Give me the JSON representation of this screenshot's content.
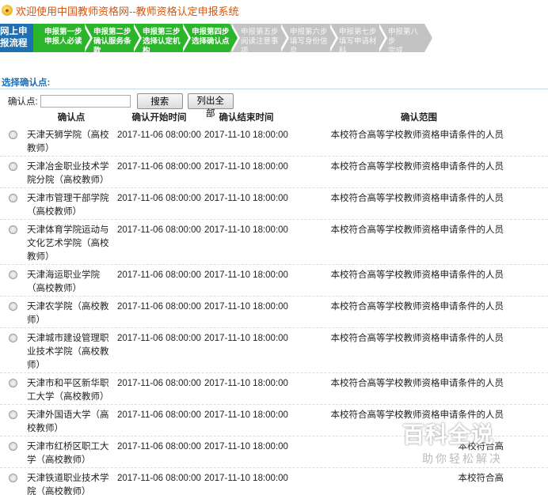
{
  "header": {
    "title": "欢迎使用中国教师资格网--教师资格认定申报系统"
  },
  "steps": [
    {
      "line1": "网上申",
      "line2": "报流程",
      "state": "current"
    },
    {
      "line1": "申报第一步",
      "line2": "申报人必读",
      "state": "done"
    },
    {
      "line1": "申报第二步",
      "line2": "确认服务条款",
      "state": "done"
    },
    {
      "line1": "申报第三步",
      "line2": "选择认定机构",
      "state": "done"
    },
    {
      "line1": "申报第四步",
      "line2": "选择确认点",
      "state": "done"
    },
    {
      "line1": "申报第五步",
      "line2": "阅读注意事项",
      "state": "todo"
    },
    {
      "line1": "申报第六步",
      "line2": "填写身份信息",
      "state": "todo"
    },
    {
      "line1": "申报第七步",
      "line2": "填写申请材料",
      "state": "todo"
    },
    {
      "line1": "申报第八步",
      "line2": "完成",
      "state": "todo"
    }
  ],
  "section": {
    "label": "选择确认点:"
  },
  "search": {
    "label": "确认点:",
    "value": "",
    "search_button": "搜索",
    "list_all_button": "列出全部"
  },
  "table": {
    "headers": [
      "确认点",
      "确认开始时间",
      "确认结束时间",
      "确认范围"
    ],
    "rows": [
      {
        "name": "天津天狮学院（高校教师）",
        "start": "2017-11-06 08:00:00",
        "end": "2017-11-10 18:00:00",
        "scope": "本校符合高等学校教师资格申请条件的人员"
      },
      {
        "name": "天津冶金职业技术学院分院（高校教师）",
        "start": "2017-11-06 08:00:00",
        "end": "2017-11-10 18:00:00",
        "scope": "本校符合高等学校教师资格申请条件的人员"
      },
      {
        "name": "天津市管理干部学院（高校教师）",
        "start": "2017-11-06 08:00:00",
        "end": "2017-11-10 18:00:00",
        "scope": "本校符合高等学校教师资格申请条件的人员"
      },
      {
        "name": "天津体育学院运动与文化艺术学院（高校教师）",
        "start": "2017-11-06 08:00:00",
        "end": "2017-11-10 18:00:00",
        "scope": "本校符合高等学校教师资格申请条件的人员"
      },
      {
        "name": "天津海运职业学院（高校教师）",
        "start": "2017-11-06 08:00:00",
        "end": "2017-11-10 18:00:00",
        "scope": "本校符合高等学校教师资格申请条件的人员"
      },
      {
        "name": "天津农学院（高校教师）",
        "start": "2017-11-06 08:00:00",
        "end": "2017-11-10 18:00:00",
        "scope": "本校符合高等学校教师资格申请条件的人员"
      },
      {
        "name": "天津城市建设管理职业技术学院（高校教师）",
        "start": "2017-11-06 08:00:00",
        "end": "2017-11-10 18:00:00",
        "scope": "本校符合高等学校教师资格申请条件的人员"
      },
      {
        "name": "天津市和平区新华职工大学（高校教师）",
        "start": "2017-11-06 08:00:00",
        "end": "2017-11-10 18:00:00",
        "scope": "本校符合高等学校教师资格申请条件的人员"
      },
      {
        "name": "天津外国语大学（高校教师）",
        "start": "2017-11-06 08:00:00",
        "end": "2017-11-10 18:00:00",
        "scope": "本校符合高等学校教师资格申请条件的人员"
      },
      {
        "name": "天津市红桥区职工大学（高校教师）",
        "start": "2017-11-06 08:00:00",
        "end": "2017-11-10 18:00:00",
        "scope": "本校符合高"
      },
      {
        "name": "天津铁道职业技术学院（高校教师）",
        "start": "2017-11-06 08:00:00",
        "end": "2017-11-10 18:00:00",
        "scope": "本校符合高"
      }
    ]
  },
  "watermark": {
    "big": "百科全说",
    "small": "助你轻松解决"
  },
  "colors": {
    "title": "#d9530a",
    "step_current": "#1f6fb3",
    "step_done": "#2ab52a",
    "step_todo": "#c3c3c3",
    "section_label": "#1f6fb3"
  }
}
